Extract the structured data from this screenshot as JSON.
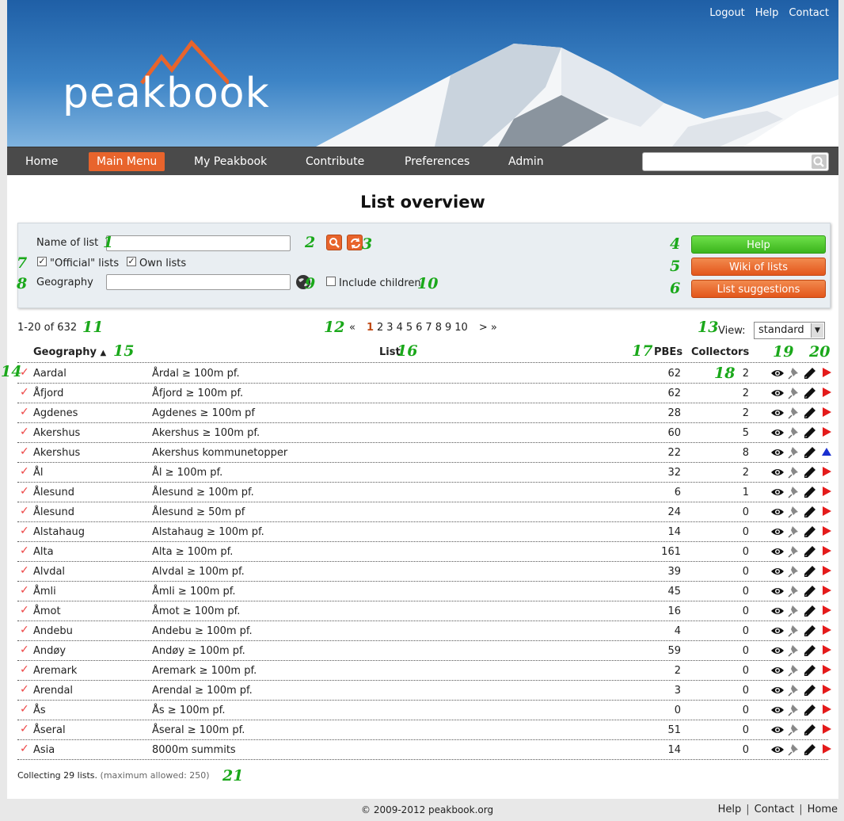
{
  "header": {
    "logo_text": "peakbook",
    "top_links": [
      "Logout",
      "Help",
      "Contact"
    ]
  },
  "nav": {
    "items": [
      "Home",
      "Main Menu",
      "My Peakbook",
      "Contribute",
      "Preferences",
      "Admin"
    ],
    "active": "Main Menu",
    "search_value": ""
  },
  "page_title": "List overview",
  "filters": {
    "name_label": "Name of list",
    "name_value": "",
    "official_label": "\"Official\" lists",
    "official_checked": true,
    "own_label": "Own lists",
    "own_checked": true,
    "geography_label": "Geography",
    "geography_value": "",
    "include_children_label": "Include children",
    "include_children_checked": false,
    "buttons": {
      "help": "Help",
      "wiki": "Wiki of lists",
      "suggestions": "List suggestions"
    }
  },
  "callouts": [
    "1",
    "2",
    "3",
    "4",
    "5",
    "6",
    "7",
    "8",
    "9",
    "10",
    "11",
    "12",
    "13",
    "14",
    "15",
    "16",
    "17",
    "18",
    "19",
    "20",
    "21"
  ],
  "pagination": {
    "count_text": "1-20 of 632",
    "prev": "«",
    "pages": [
      "1",
      "2",
      "3",
      "4",
      "5",
      "6",
      "7",
      "8",
      "9",
      "10"
    ],
    "current": "1",
    "next": "> »"
  },
  "view": {
    "label": "View:",
    "selected": "standard"
  },
  "table": {
    "headers": {
      "geography": "Geography",
      "sort_arrow": "▲",
      "list": "List",
      "pbes": "PBEs",
      "collectors": "Collectors"
    },
    "rows": [
      {
        "geo": "Aardal",
        "list": "Årdal ≥ 100m pf.",
        "pbes": "62",
        "collectors": "2",
        "status": "red"
      },
      {
        "geo": "Åfjord",
        "list": "Åfjord ≥ 100m pf.",
        "pbes": "62",
        "collectors": "2",
        "status": "red"
      },
      {
        "geo": "Agdenes",
        "list": "Agdenes ≥ 100m pf",
        "pbes": "28",
        "collectors": "2",
        "status": "red"
      },
      {
        "geo": "Akershus",
        "list": "Akershus ≥ 100m pf.",
        "pbes": "60",
        "collectors": "5",
        "status": "red"
      },
      {
        "geo": "Akershus",
        "list": "Akershus kommunetopper",
        "pbes": "22",
        "collectors": "8",
        "status": "blue"
      },
      {
        "geo": "Ål",
        "list": "Ål ≥ 100m pf.",
        "pbes": "32",
        "collectors": "2",
        "status": "red"
      },
      {
        "geo": "Ålesund",
        "list": "Ålesund ≥ 100m pf.",
        "pbes": "6",
        "collectors": "1",
        "status": "red"
      },
      {
        "geo": "Ålesund",
        "list": "Ålesund ≥ 50m pf",
        "pbes": "24",
        "collectors": "0",
        "status": "red"
      },
      {
        "geo": "Alstahaug",
        "list": "Alstahaug ≥ 100m pf.",
        "pbes": "14",
        "collectors": "0",
        "status": "red"
      },
      {
        "geo": "Alta",
        "list": "Alta ≥ 100m pf.",
        "pbes": "161",
        "collectors": "0",
        "status": "red"
      },
      {
        "geo": "Alvdal",
        "list": "Alvdal ≥ 100m pf.",
        "pbes": "39",
        "collectors": "0",
        "status": "red"
      },
      {
        "geo": "Åmli",
        "list": "Åmli ≥ 100m pf.",
        "pbes": "45",
        "collectors": "0",
        "status": "red"
      },
      {
        "geo": "Åmot",
        "list": "Åmot ≥ 100m pf.",
        "pbes": "16",
        "collectors": "0",
        "status": "red"
      },
      {
        "geo": "Andebu",
        "list": "Andebu ≥ 100m pf.",
        "pbes": "4",
        "collectors": "0",
        "status": "red"
      },
      {
        "geo": "Andøy",
        "list": "Andøy ≥ 100m pf.",
        "pbes": "59",
        "collectors": "0",
        "status": "red"
      },
      {
        "geo": "Aremark",
        "list": "Aremark ≥ 100m pf.",
        "pbes": "2",
        "collectors": "0",
        "status": "red"
      },
      {
        "geo": "Arendal",
        "list": "Arendal ≥ 100m pf.",
        "pbes": "3",
        "collectors": "0",
        "status": "red"
      },
      {
        "geo": "Ås",
        "list": "Ås ≥ 100m pf.",
        "pbes": "0",
        "collectors": "0",
        "status": "red"
      },
      {
        "geo": "Åseral",
        "list": "Åseral ≥ 100m pf.",
        "pbes": "51",
        "collectors": "0",
        "status": "red"
      },
      {
        "geo": "Asia",
        "list": "8000m summits",
        "pbes": "14",
        "collectors": "0",
        "status": "red"
      }
    ]
  },
  "footer": {
    "collecting": "Collecting 29 lists.",
    "maximum": "(maximum allowed: 250)",
    "copyright": "© 2009-2012 peakbook.org",
    "links": [
      "Help",
      "Contact",
      "Home"
    ]
  },
  "colors": {
    "accent": "#e8642c",
    "green_button": "#3bb51c",
    "callout": "#1aa81a",
    "nav_bg": "#4a4a4a"
  }
}
